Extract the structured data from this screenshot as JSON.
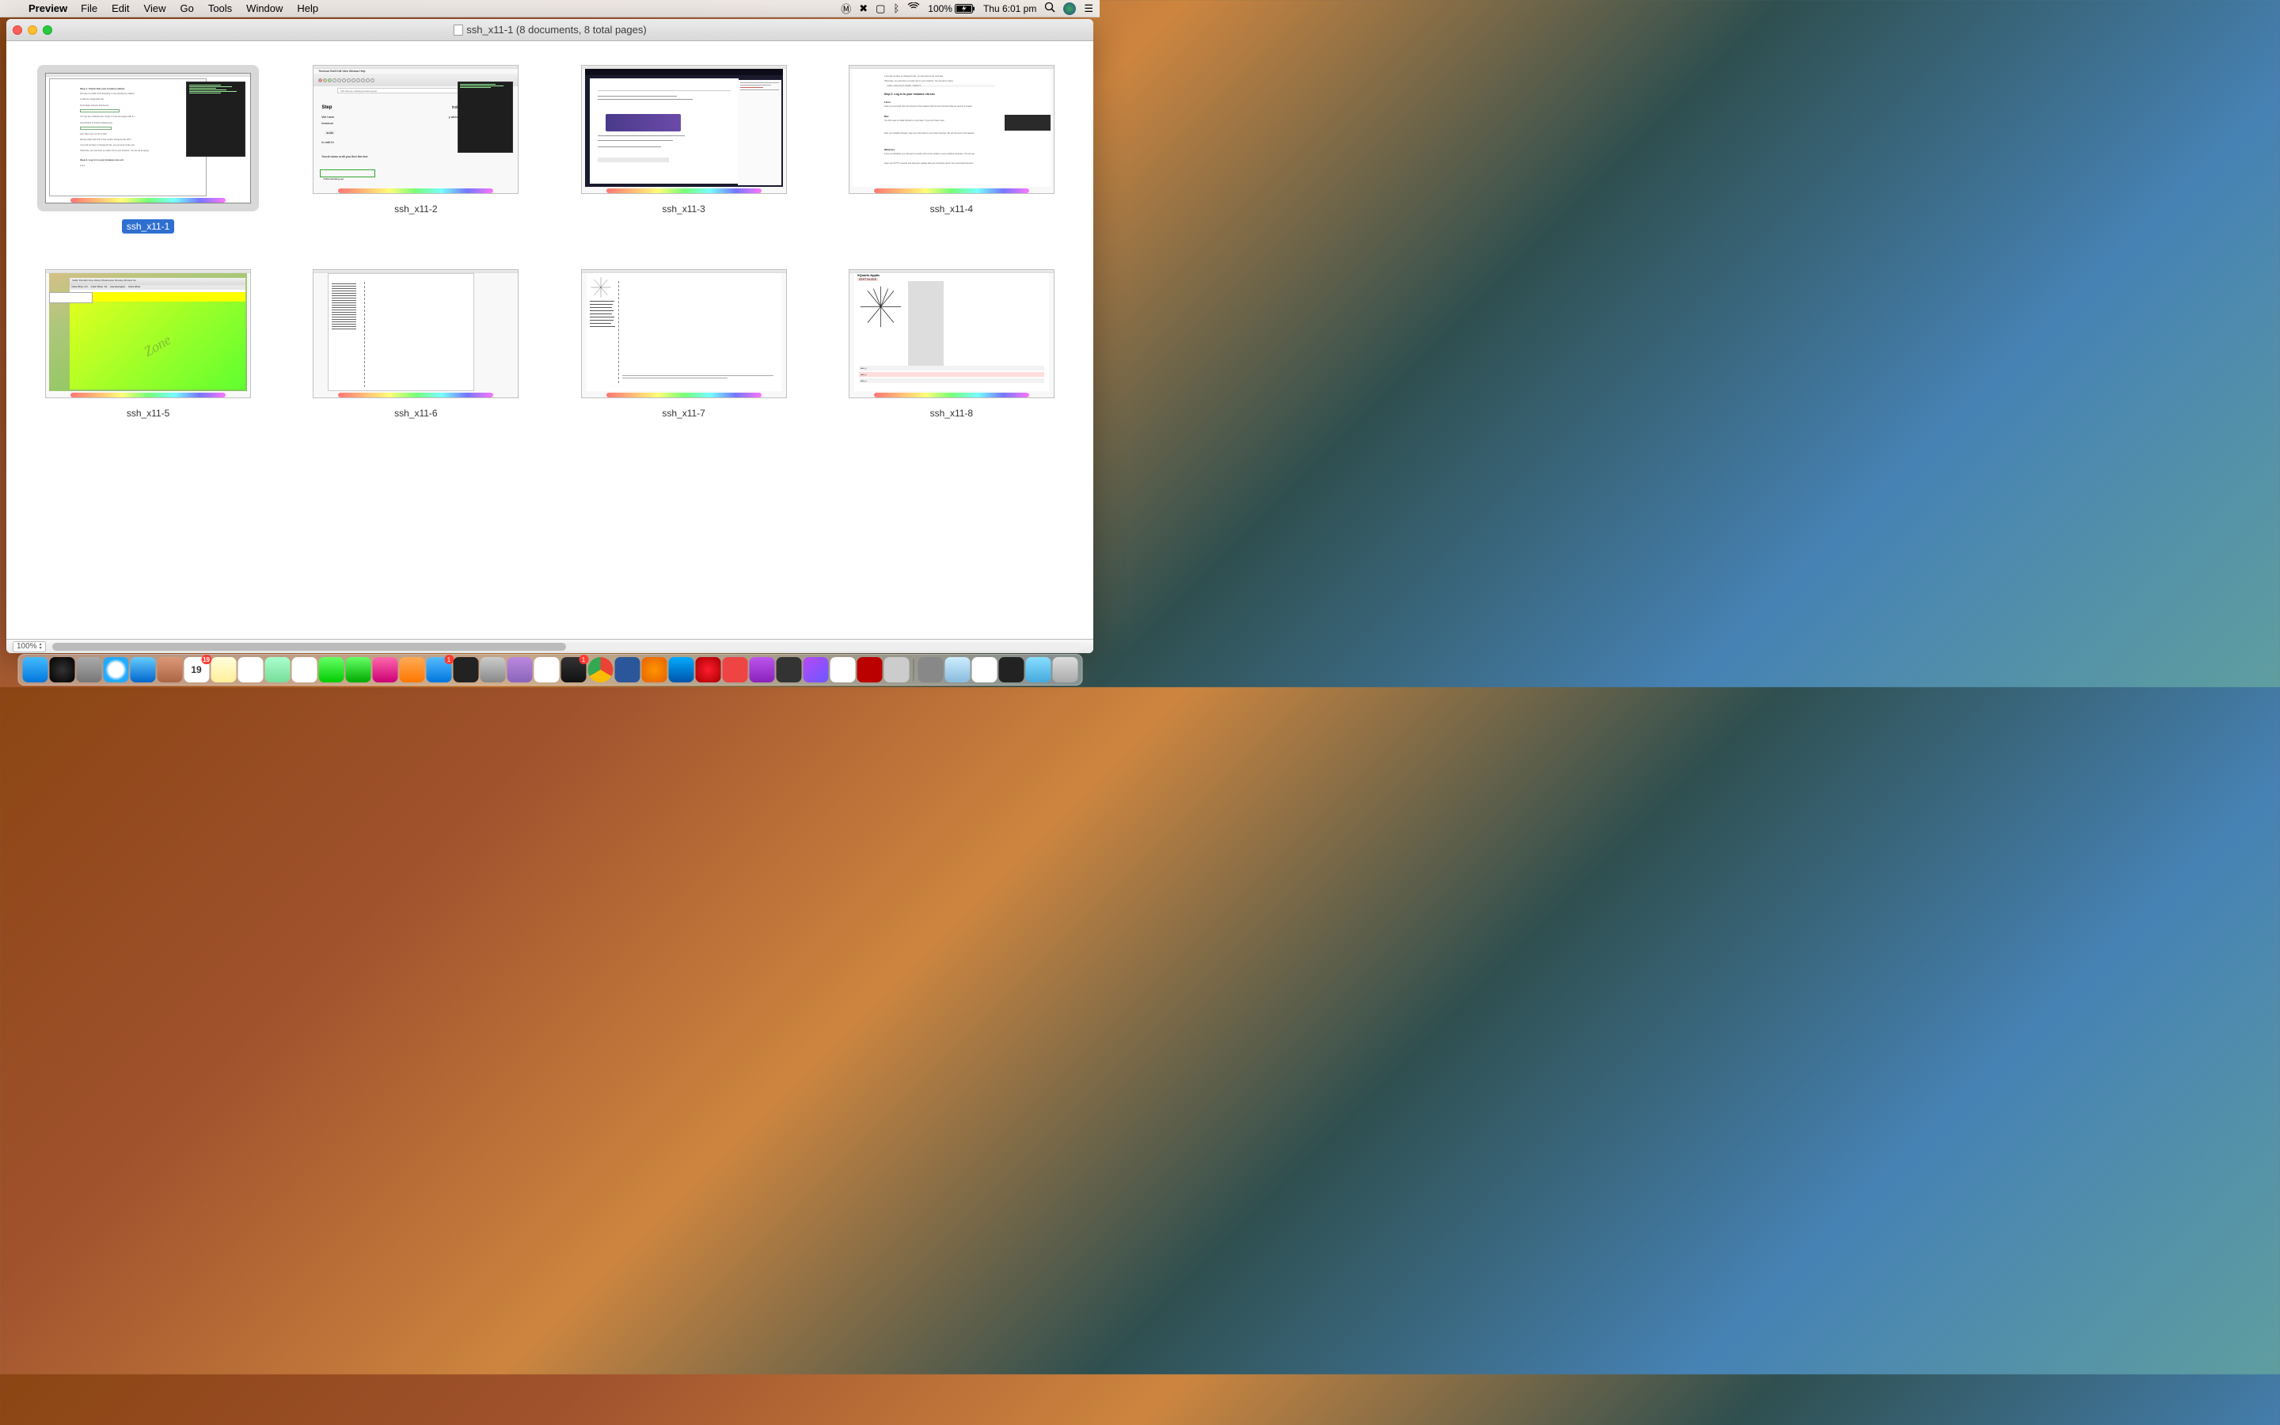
{
  "menubar": {
    "app_name": "Preview",
    "menus": [
      "File",
      "Edit",
      "View",
      "Go",
      "Tools",
      "Window",
      "Help"
    ],
    "battery_pct": "100%",
    "clock": "Thu 6:01 pm"
  },
  "window": {
    "title": "ssh_x11-1 (8 documents, 8 total pages)"
  },
  "thumbnails": [
    {
      "label": "ssh_x11-1",
      "selected": true
    },
    {
      "label": "ssh_x11-2",
      "selected": false
    },
    {
      "label": "ssh_x11-3",
      "selected": false
    },
    {
      "label": "ssh_x11-4",
      "selected": false
    },
    {
      "label": "ssh_x11-5",
      "selected": false
    },
    {
      "label": "ssh_x11-6",
      "selected": false
    },
    {
      "label": "ssh_x11-7",
      "selected": false
    },
    {
      "label": "ssh_x11-8",
      "selected": false
    }
  ],
  "thumb_content": {
    "t1": {
      "heading": "Step 1. Check that your Instance allows",
      "para1": "We have to enable X11 forwarding. It may already be enabled",
      "sub1": "to edit the configuration file",
      "sub2": "Scroll down until you find the line",
      "sub3": "If X may be in default Linux config, if X this line begins with #, n",
      "sub4": "Scroll further to find the following line",
      "sub5": "X11Forwarding yes",
      "sub6": "and make sure it is set to YES",
      "sub7": "Exit the editor with Ctrl+X and confirm saving the file with Y",
      "sub8": "If you did not have to change the file, you can jump to the next",
      "sub9": "Otherwise, you now have to restart ssh on your instance. You can do by typing",
      "step2": "Step 2. Log in to your instance via ssh",
      "linux": "Linux"
    },
    "t2": {
      "menubar": "Terminal  Shell  Edit  View  Window  Help",
      "url": "Not Secure | training.nectar.org.au",
      "step": "Step",
      "wehave": "We have",
      "terminal": "terminal",
      "sudo": "sudo",
      "toedit": "to edit th",
      "scroll": "Scroll down until you find the line",
      "x11f": "X11Forwarding yes",
      "instance": "instance",
      "already": "y already b"
    },
    "t3": {
      "stackoverflow": "stackoverflow"
    },
    "t4": {
      "step2": "Step 2. Log in to your instance via ssh",
      "linux": "Linux",
      "mac": "Mac",
      "windows": "Windows",
      "note1": "If you did not have to change the file, you can jump to the next step.",
      "note2": "Otherwise, you now have to restart ssh on your instance. You can do by typing",
      "cmd": "sudo /etc/init.d/ssh restart",
      "open": "Open up a terminal. We will connect to the instance with the ssh command that we used in an earlier",
      "needxq": "You first need to install XQuartz on your Mac. If you don't have it alre",
      "afterxq": "After you installed XQuartz, open up a Terminal on your local computer. We will connect to the instance",
      "ifwin": "If you use Windows you will need to install a X11 server locally on your windows computer. You can use",
      "putty": "Open your PuTTY session and load your settings that you previously saved. Go to and select Session"
    },
    "t5": {
      "safari_menu": "Safari  File  Edit  View  History  Bookmarks  Develop  Window  He",
      "tab1": "Colour Wheel - RJ...",
      "tab2": "Colour Wheel - RJ...",
      "url": "www.rjmprogram...",
      "tab3": "Colour Wheel",
      "zone": "Zone"
    },
    "t7": {
      "items": [
        "aaa_nnn_n",
        "aaa_nnn_n",
        "aaa_gbfq",
        "aaa_nnn_n",
        "hubbad.txt",
        "aaa_nnn_n",
        "aaa_nnn_n",
        "hddx.html",
        "aaa_nnn_n"
      ]
    },
    "t8": {
      "xquartz": "XQuartz  Applic",
      "time": "CEST 04:33:5",
      "rows": [
        "aaa_n",
        "aaa_n",
        "aaa_n"
      ]
    }
  },
  "statusbar": {
    "zoom": "100%"
  },
  "dock": {
    "badges": {
      "mail": "19",
      "app1": "1",
      "app2": "1"
    }
  }
}
